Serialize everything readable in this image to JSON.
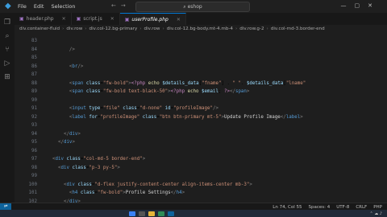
{
  "menu": [
    "File",
    "Edit",
    "Selection"
  ],
  "search": "eshop",
  "tabs": [
    {
      "name": "header.php",
      "active": false
    },
    {
      "name": "script.js",
      "active": false
    },
    {
      "name": "userProfile.php",
      "active": true
    }
  ],
  "breadcrumbs": [
    "div.container-fluid",
    "div.row",
    "div.col-12.bg-primary",
    "div.row",
    "div.col-12.bg-body.mt-4.mb-4",
    "div.row.g-2",
    "div.col-md-3.border-end"
  ],
  "code": [
    {
      "n": "83",
      "html": ""
    },
    {
      "n": "84",
      "html": "        <span class=\"tg\">/&gt;</span>"
    },
    {
      "n": "85",
      "html": ""
    },
    {
      "n": "86",
      "html": "        <span class=\"tg\">&lt;</span><span class=\"tn\">br</span><span class=\"tg\">/&gt;</span>"
    },
    {
      "n": "87",
      "html": ""
    },
    {
      "n": "88",
      "html": "        <span class=\"tg\">&lt;</span><span class=\"tn\">span</span> <span class=\"at\">class</span>=<span class=\"st\">\"fw-bold\"</span><span class=\"tg\">&gt;</span><span class=\"php\">&lt;?php</span> <span class=\"kw\">echo</span> <span class=\"var\">$details_data</span>[<span class=\"st\">\"fname\"</span>] . <span class=\"st\">\" \"</span>. <span class=\"var\">$details_data</span>[<span class=\"st\">\"lname\"</span>"
    },
    {
      "n": "89",
      "html": "        <span class=\"tg\">&lt;</span><span class=\"tn\">span</span> <span class=\"at\">class</span>=<span class=\"st\">\"fw-bold text-black-50\"</span><span class=\"tg\">&gt;</span><span class=\"php\">&lt;?php</span> <span class=\"kw\">echo</span> <span class=\"var\">$email</span>; <span class=\"php\">?&gt;</span><span class=\"tg\">&lt;/</span><span class=\"tn\">span</span><span class=\"tg\">&gt;</span>"
    },
    {
      "n": "90",
      "html": ""
    },
    {
      "n": "91",
      "html": "        <span class=\"tg\">&lt;</span><span class=\"tn\">input</span> <span class=\"at\">type</span>=<span class=\"st\">\"file\"</span> <span class=\"at\">class</span>=<span class=\"st\">\"d-none\"</span> <span class=\"at\">id</span>=<span class=\"st\">\"profileImage\"</span><span class=\"tg\">/&gt;</span>"
    },
    {
      "n": "92",
      "html": "        <span class=\"tg\">&lt;</span><span class=\"tn\">label</span> <span class=\"at\">for</span>=<span class=\"st\">\"profileImage\"</span> <span class=\"at\">class</span>=<span class=\"st\">\"btn btn-primary mt-5\"</span><span class=\"tg\">&gt;</span><span class=\"tx\">Update Profile Image</span><span class=\"tg\">&lt;/</span><span class=\"tn\">label</span><span class=\"tg\">&gt;</span>"
    },
    {
      "n": "93",
      "html": ""
    },
    {
      "n": "94",
      "html": "      <span class=\"tg\">&lt;/</span><span class=\"tn\">div</span><span class=\"tg\">&gt;</span>"
    },
    {
      "n": "95",
      "html": "    <span class=\"tg\">&lt;/</span><span class=\"tn\">div</span><span class=\"tg\">&gt;</span>"
    },
    {
      "n": "96",
      "html": ""
    },
    {
      "n": "97",
      "html": "  <span class=\"tg\">&lt;</span><span class=\"tn\">div</span> <span class=\"at\">class</span>=<span class=\"st\">\"col-md-5 border-end\"</span><span class=\"tg\">&gt;</span>"
    },
    {
      "n": "98",
      "html": "    <span class=\"tg\">&lt;</span><span class=\"tn\">div</span> <span class=\"at\">class</span>=<span class=\"st\">\"p-3 py-5\"</span><span class=\"tg\">&gt;</span>"
    },
    {
      "n": "99",
      "html": ""
    },
    {
      "n": "100",
      "html": "      <span class=\"tg\">&lt;</span><span class=\"tn\">div</span> <span class=\"at\">class</span>=<span class=\"st\">\"d-flex justify-content-center align-items-center mb-3\"</span><span class=\"tg\">&gt;</span>"
    },
    {
      "n": "101",
      "html": "        <span class=\"tg\">&lt;</span><span class=\"tn\">h4</span> <span class=\"at\">class</span>=<span class=\"st\">\"fw-bold\"</span><span class=\"tg\">&gt;</span><span class=\"tx\">Profile Settings</span><span class=\"tg\">&lt;/</span><span class=\"tn\">h4</span><span class=\"tg\">&gt;</span>"
    },
    {
      "n": "102",
      "html": "      <span class=\"tg\">&lt;/</span><span class=\"tn\">div</span><span class=\"tg\">&gt;</span>"
    }
  ],
  "status": {
    "position": "Ln 74, Col 55",
    "spaces": "Spaces: 4",
    "encoding": "UTF-8",
    "eol": "CRLF",
    "language": "PHP"
  },
  "colors": {
    "accent": "#0078d4",
    "background": "#1e1e1e"
  }
}
